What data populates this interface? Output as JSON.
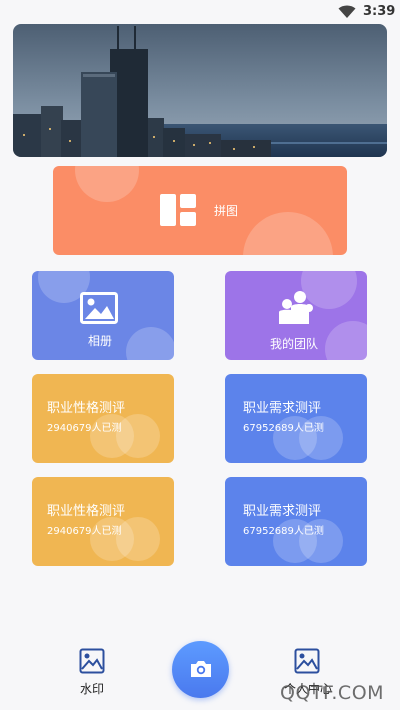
{
  "status": {
    "time": "3:39"
  },
  "grid": {
    "pintu_label": "拼图",
    "album_label": "相册",
    "team_label": "我的团队",
    "test1": {
      "title": "职业性格测评",
      "count": "2940679人已测"
    },
    "test2": {
      "title": "职业需求测评",
      "count": "67952689人已测"
    },
    "test3": {
      "title": "职业性格测评",
      "count": "2940679人已测"
    },
    "test4": {
      "title": "职业需求测评",
      "count": "67952689人已测"
    }
  },
  "bottom_nav": {
    "left_label": "水印",
    "right_label": "个人中心",
    "left_icon": "image-icon",
    "center_icon": "camera-icon",
    "right_icon": "image-icon"
  },
  "watermark_text": "QQTF.COM",
  "colors": {
    "pintu": "#fb8d66",
    "album": "#6b86e6",
    "team": "#9d74e8",
    "yellow_card": "#f0b652",
    "blue_card": "#5c83eb",
    "camera": "#4a79ee"
  }
}
